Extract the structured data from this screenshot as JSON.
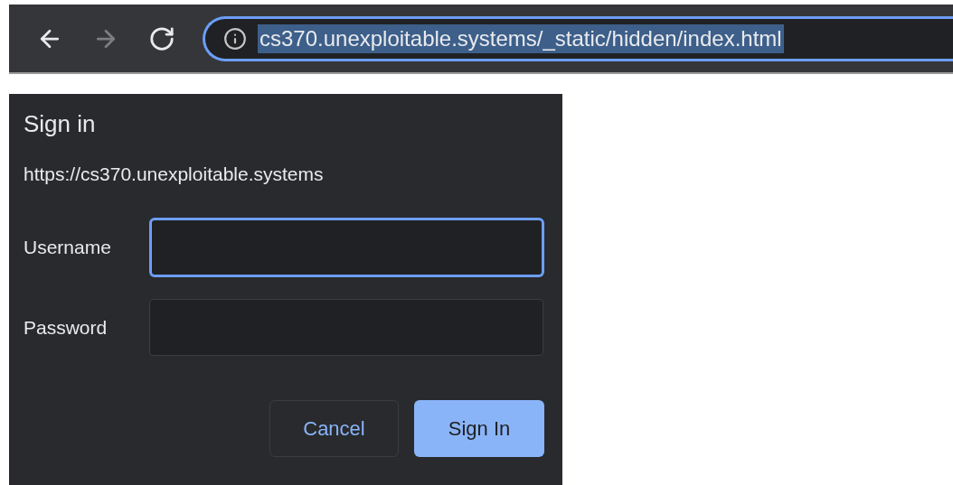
{
  "toolbar": {
    "nav_buttons": [
      {
        "kind": "back",
        "disabled": false
      },
      {
        "kind": "forward",
        "disabled": true
      },
      {
        "kind": "reload",
        "disabled": false
      }
    ],
    "address_bar": {
      "url": "cs370.unexploitable.systems/_static/hidden/index.html",
      "selected": true,
      "focused": true
    }
  },
  "dialog": {
    "title": "Sign in",
    "origin": "https://cs370.unexploitable.systems",
    "fields": [
      {
        "label": "Username",
        "focused": true
      },
      {
        "label": "Password",
        "focused": false
      }
    ],
    "buttons": [
      {
        "label": "Cancel",
        "kind": "secondary"
      },
      {
        "label": "Sign In",
        "kind": "primary"
      }
    ]
  }
}
